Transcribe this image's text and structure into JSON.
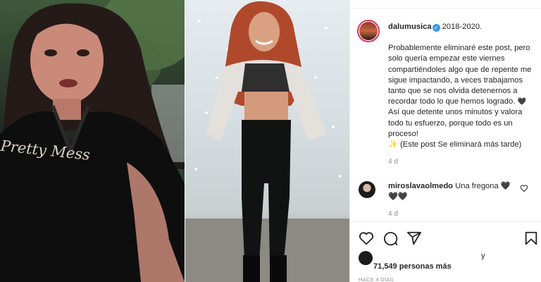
{
  "post": {
    "owner": {
      "username": "dalumusica",
      "verified": true,
      "avatar": "profile-avatar"
    },
    "caption": {
      "title": "2018-2020.",
      "body_part1": "Probablemente eliminaré este post, pero solo quería empezar este viernes compartiéndoles algo que de repente me sigue impactando, a veces trabajamos tanto que se nos olvida detenernos a recordar todo lo que hemos logrado. ",
      "heart_emoji": "🖤",
      "body_part2": " Así que detente unos minutos y valora todo tu esfuerzo, porque todo es un proceso!",
      "sparkle_emoji": "✨",
      "body_part3": " (Este post Se eliminará más tarde)",
      "time": "4 d"
    },
    "comments": [
      {
        "username": "miroslavaolmedo",
        "text": "Una fregona",
        "hearts": "🖤 🖤🖤",
        "time": "4 d"
      }
    ],
    "actions": {
      "like": "heart-icon",
      "comment": "comment-icon",
      "share": "share-icon",
      "save": "bookmark-icon"
    },
    "likes": {
      "tail": "y",
      "count_text": "71,549 personas más"
    },
    "posted_ago": "HACE 4 DÍAS",
    "photos": {
      "left_shirt_text": "Pretty Mess"
    }
  },
  "colors": {
    "verified": "#3897f0",
    "muted": "#8e8e8e",
    "text": "#262626"
  }
}
